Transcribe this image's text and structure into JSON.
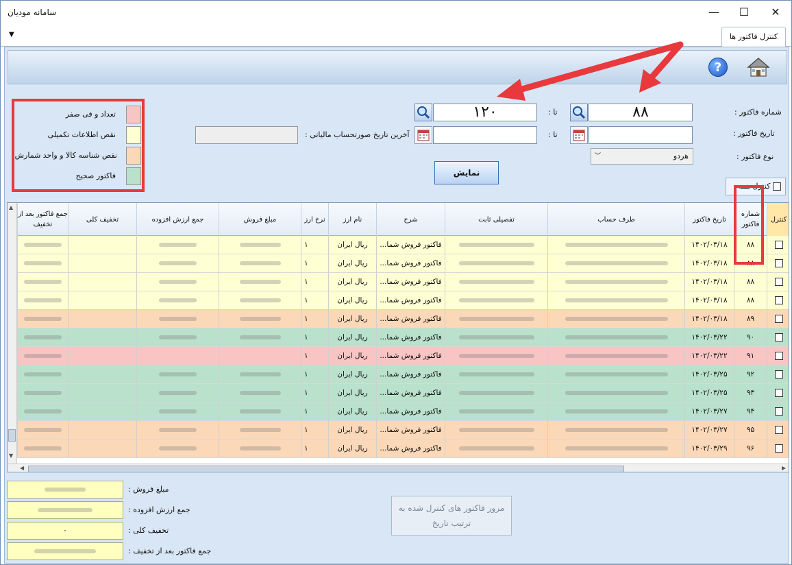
{
  "window": {
    "title": "سامانه مودیان",
    "minimize": "—",
    "maximize": "☐",
    "close": "✕"
  },
  "tab": {
    "label": "کنترل فاکتور ها"
  },
  "colors": {
    "zero_qty": "#f8c4c4",
    "incomplete": "#ffffd4",
    "missing_id": "#fbd8b8",
    "valid": "#b9e1cc",
    "highlight": "#e8393d"
  },
  "filters": {
    "invoice_no_label": "شماره فاکتور :",
    "invoice_no_from": "۸۸",
    "invoice_no_to": "۱۲۰",
    "to_label": "تا :",
    "invoice_date_label": "تاریخ فاکتور :",
    "invoice_date_from": "",
    "invoice_date_to": "",
    "last_period_label": "آخرین تاریخ صورتحساب مالیاتی :",
    "last_period_value": "",
    "invoice_type_label": "نوع فاکتور :",
    "invoice_type_value": "هردو",
    "show_button": "نمایش",
    "control_all": "کنترل همه"
  },
  "legend": [
    {
      "label": "تعداد و فی صفر",
      "color": "#f8c4c4"
    },
    {
      "label": "نقص اطلاعات تکمیلی",
      "color": "#ffffd4"
    },
    {
      "label": "نقص شناسه کالا و واحد شمارش",
      "color": "#fbd8b8"
    },
    {
      "label": "فاکتور صحیح",
      "color": "#b9e1cc"
    }
  ],
  "table": {
    "headers": [
      "کنترل",
      "شماره فاکتور",
      "تاریخ فاکتور",
      "طرف حساب",
      "تفصیلی ثابت",
      "شرح",
      "نام ارز",
      "نرخ ارز",
      "مبلغ فروش",
      "جمع ارزش افزوده",
      "تخفیف کلی",
      "جمع فاکتور بعد از تخفیف"
    ],
    "rows": [
      {
        "no": "۸۸",
        "date": "۱۴۰۲/۰۳/۱۸",
        "desc": "فاکتور فروش شما...",
        "currency": "ریال ایران",
        "rate": "۱",
        "status": "incomplete"
      },
      {
        "no": "۸۸",
        "date": "۱۴۰۲/۰۳/۱۸",
        "desc": "فاکتور فروش شما...",
        "currency": "ریال ایران",
        "rate": "۱",
        "status": "incomplete"
      },
      {
        "no": "۸۸",
        "date": "۱۴۰۲/۰۳/۱۸",
        "desc": "فاکتور فروش شما...",
        "currency": "ریال ایران",
        "rate": "۱",
        "status": "incomplete"
      },
      {
        "no": "۸۸",
        "date": "۱۴۰۲/۰۳/۱۸",
        "desc": "فاکتور فروش شما...",
        "currency": "ریال ایران",
        "rate": "۱",
        "status": "incomplete"
      },
      {
        "no": "۸۹",
        "date": "۱۴۰۲/۰۳/۱۸",
        "desc": "فاکتور فروش شما...",
        "currency": "ریال ایران",
        "rate": "۱",
        "status": "missing_id"
      },
      {
        "no": "۹۰",
        "date": "۱۴۰۲/۰۳/۲۲",
        "desc": "فاکتور فروش شما...",
        "currency": "ریال ایران",
        "rate": "۱",
        "status": "valid"
      },
      {
        "no": "۹۱",
        "date": "۱۴۰۲/۰۳/۲۲",
        "desc": "فاکتور فروش شما...",
        "currency": "ریال ایران",
        "rate": "۱",
        "status": "zero_qty"
      },
      {
        "no": "۹۲",
        "date": "۱۴۰۲/۰۳/۲۵",
        "desc": "فاکتور فروش شما...",
        "currency": "ریال ایران",
        "rate": "۱",
        "status": "valid"
      },
      {
        "no": "۹۳",
        "date": "۱۴۰۲/۰۳/۲۵",
        "desc": "فاکتور فروش شما...",
        "currency": "ریال ایران",
        "rate": "۱",
        "status": "valid"
      },
      {
        "no": "۹۴",
        "date": "۱۴۰۲/۰۳/۲۷",
        "desc": "فاکتور فروش شما...",
        "currency": "ریال ایران",
        "rate": "۱",
        "status": "valid"
      },
      {
        "no": "۹۵",
        "date": "۱۴۰۲/۰۳/۲۷",
        "desc": "فاکتور فروش شما...",
        "currency": "ریال ایران",
        "rate": "۱",
        "status": "missing_id"
      },
      {
        "no": "۹۶",
        "date": "۱۴۰۲/۰۳/۲۹",
        "desc": "فاکتور فروش شما...",
        "currency": "ریال ایران",
        "rate": "۱",
        "status": "missing_id"
      }
    ]
  },
  "summary": {
    "sales_label": "مبلغ فروش :",
    "vat_label": "جمع ارزش افزوده :",
    "discount_label": "تخفیف کلی :",
    "discount_value": "۰",
    "total_label": "جمع فاکتور بعد از تخفیف :",
    "review_button": "مرور فاکتور های کنترل شده به ترتیب تاریخ"
  }
}
